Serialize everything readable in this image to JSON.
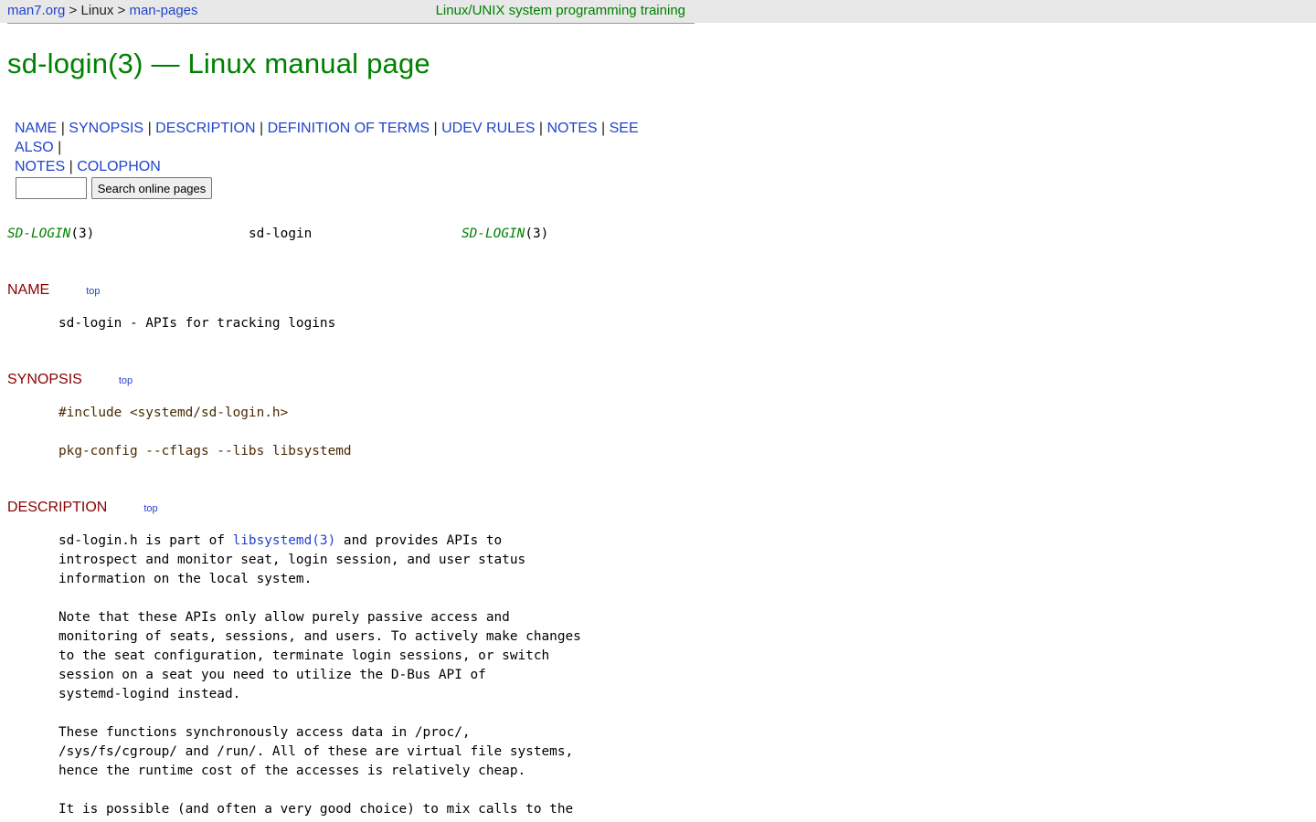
{
  "breadcrumb": {
    "home": "man7.org",
    "sep1": " > ",
    "linux": "Linux",
    "sep2": " > ",
    "manpages": "man-pages"
  },
  "training_link": "Linux/UNIX system programming training",
  "title": "sd-login(3) — Linux manual page",
  "toc": [
    "NAME",
    "SYNOPSIS",
    "DESCRIPTION",
    "DEFINITION OF TERMS",
    "UDEV RULES",
    "NOTES",
    "SEE ALSO",
    "NOTES",
    "COLOPHON"
  ],
  "search": {
    "value": "",
    "button": "Search online pages"
  },
  "man_header": {
    "left_name": "SD-LOGIN",
    "left_sect": "(3)",
    "center": "sd-login",
    "right_name": "SD-LOGIN",
    "right_sect": "(3)"
  },
  "sections": {
    "name": {
      "heading": "NAME",
      "top": "top",
      "text": "sd-login - APIs for tracking logins"
    },
    "synopsis": {
      "heading": "SYNOPSIS",
      "top": "top",
      "include": "#include <systemd/sd-login.h>",
      "pkgconfig": "pkg-config --cflags --libs libsystemd"
    },
    "description": {
      "heading": "DESCRIPTION",
      "top": "top",
      "p1_pre": "sd-login.h is part of ",
      "p1_link": "libsystemd(3)",
      "p1_post": " and provides APIs to\nintrospect and monitor seat, login session, and user status\ninformation on the local system.",
      "p2": "Note that these APIs only allow purely passive access and\nmonitoring of seats, sessions, and users. To actively make changes\nto the seat configuration, terminate login sessions, or switch\nsession on a seat you need to utilize the D-Bus API of\nsystemd-logind instead.",
      "p3": "These functions synchronously access data in /proc/,\n/sys/fs/cgroup/ and /run/. All of these are virtual file systems,\nhence the runtime cost of the accesses is relatively cheap.",
      "p4": "It is possible (and often a very good choice) to mix calls to the"
    }
  }
}
